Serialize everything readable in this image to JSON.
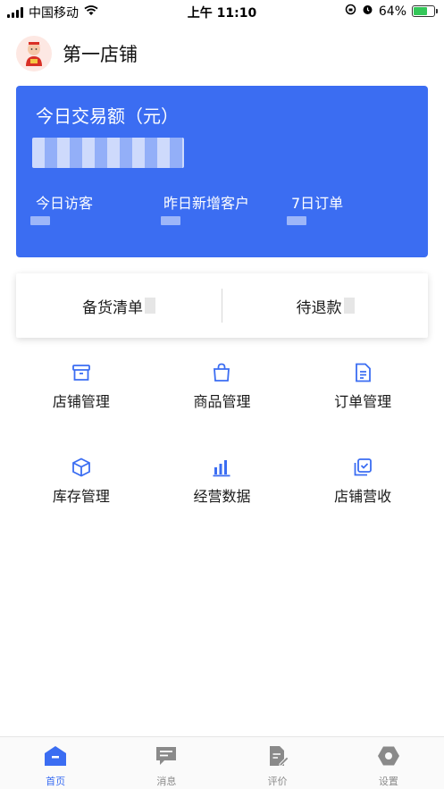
{
  "status_bar": {
    "carrier": "中国移动",
    "time": "上午 11:10",
    "battery_percent": "64%",
    "battery_level": 0.64
  },
  "header": {
    "shop_name": "第一店铺"
  },
  "summary_card": {
    "title": "今日交易额（元）",
    "stats": [
      {
        "label": "今日访客"
      },
      {
        "label": "昨日新增客户"
      },
      {
        "label": "7日订单"
      }
    ]
  },
  "quick_panel": {
    "stock_list_label": "备货清单",
    "pending_refund_label": "待退款"
  },
  "menu": [
    {
      "label": "店铺管理",
      "icon": "store-icon"
    },
    {
      "label": "商品管理",
      "icon": "bag-icon"
    },
    {
      "label": "订单管理",
      "icon": "document-icon"
    },
    {
      "label": "库存管理",
      "icon": "box-icon"
    },
    {
      "label": "经营数据",
      "icon": "bar-chart-icon"
    },
    {
      "label": "店铺营收",
      "icon": "revenue-icon"
    }
  ],
  "tabbar": [
    {
      "label": "首页",
      "icon": "home-icon",
      "active": true
    },
    {
      "label": "消息",
      "icon": "message-icon",
      "active": false
    },
    {
      "label": "评价",
      "icon": "review-icon",
      "active": false
    },
    {
      "label": "设置",
      "icon": "settings-icon",
      "active": false
    }
  ],
  "colors": {
    "accent": "#3b6df2",
    "tab_inactive": "#8a8a8a"
  }
}
